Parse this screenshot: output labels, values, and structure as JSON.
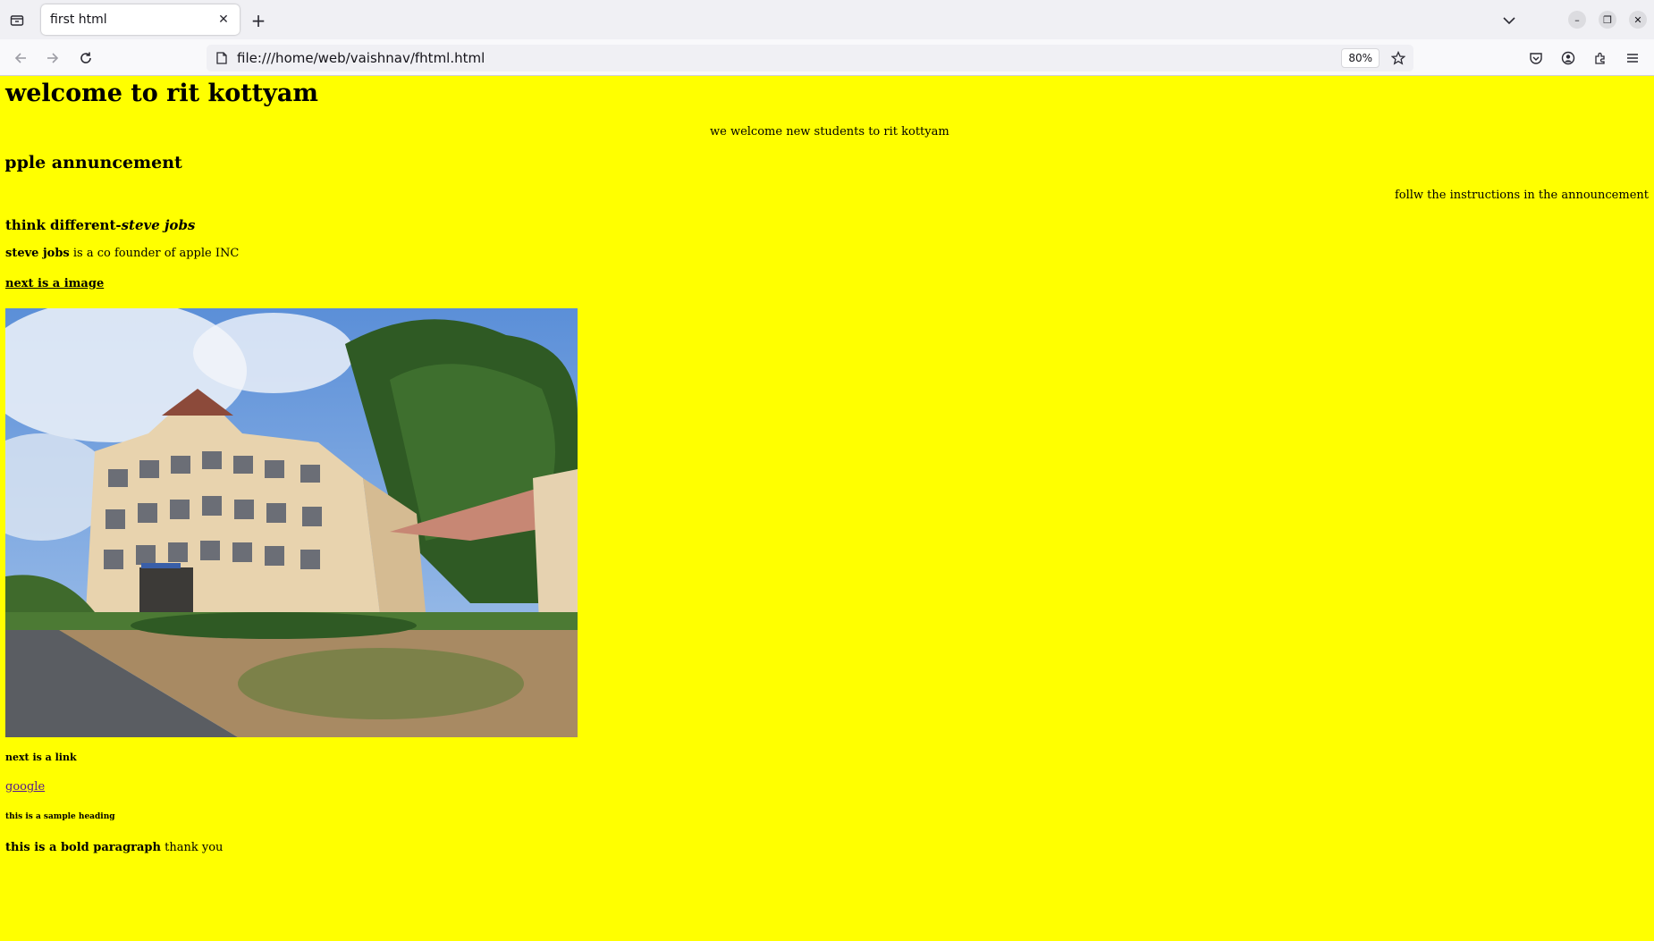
{
  "browser": {
    "tab_title": "first html",
    "url": "file:///home/web/vaishnav/fhtml.html",
    "zoom": "80%"
  },
  "page": {
    "heading": "welcome to rit kottyam",
    "centered_text": "we welcome new students to rit kottyam",
    "marquee_heading": "apple annuncement",
    "right_text": "follw the instructions in the announcement",
    "quote_plain": "think different-",
    "quote_italic": "steve jobs",
    "para_bold": "steve jobs",
    "para_rest": " is a co founder of apple INC",
    "underlined_heading": "next is a image",
    "link_label": "next is a link",
    "link_text": "google",
    "small_heading": "this is a sample heading",
    "final_bold": "this is a bold paragraph",
    "final_rest": " thank you"
  },
  "colors": {
    "page_background": "#ffff00"
  }
}
